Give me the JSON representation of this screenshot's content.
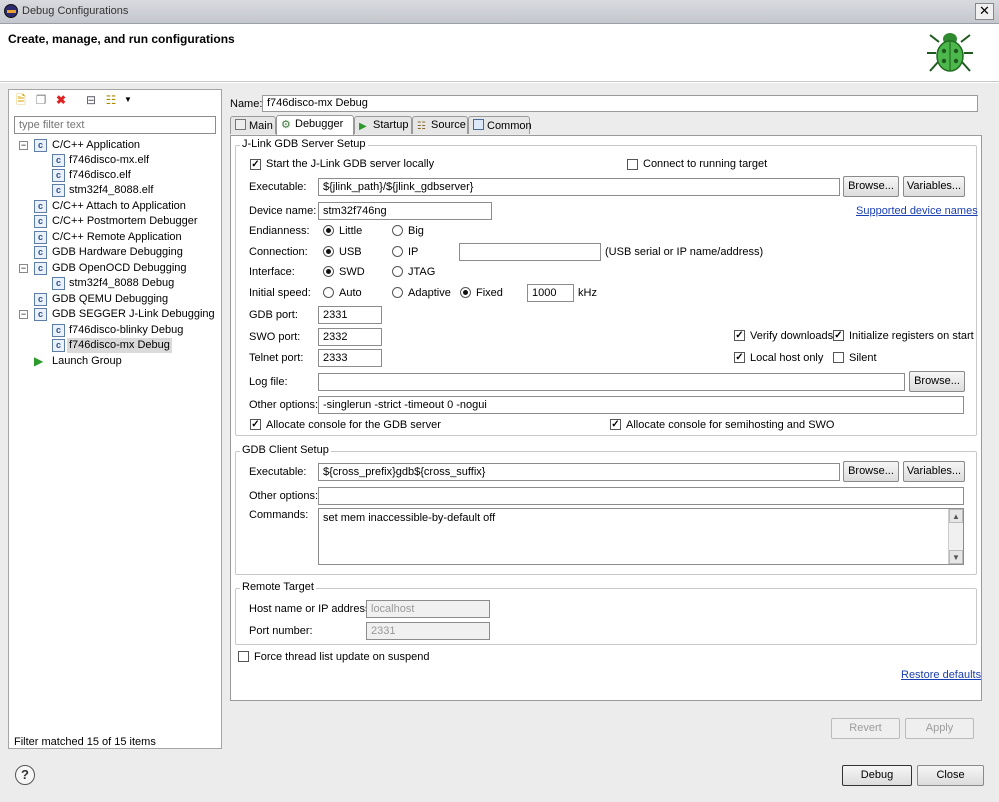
{
  "window": {
    "title": "Debug Configurations",
    "header": "Create, manage, and run configurations",
    "close_glyph": "✕"
  },
  "toolbar": {
    "icons": [
      "new-config-icon",
      "duplicate-icon",
      "delete-icon",
      "collapse-all-icon",
      "filter-icon"
    ]
  },
  "filter": {
    "placeholder": "type filter text",
    "status": "Filter matched 15 of 15 items"
  },
  "tree": [
    {
      "label": "C/C++ Application",
      "level": 0,
      "expanded": true
    },
    {
      "label": "f746disco-mx.elf",
      "level": 1
    },
    {
      "label": "f746disco.elf",
      "level": 1
    },
    {
      "label": "stm32f4_8088.elf",
      "level": 1
    },
    {
      "label": "C/C++ Attach to Application",
      "level": 0
    },
    {
      "label": "C/C++ Postmortem Debugger",
      "level": 0
    },
    {
      "label": "C/C++ Remote Application",
      "level": 0
    },
    {
      "label": "GDB Hardware Debugging",
      "level": 0
    },
    {
      "label": "GDB OpenOCD Debugging",
      "level": 0,
      "expanded": true
    },
    {
      "label": "stm32f4_8088 Debug",
      "level": 1
    },
    {
      "label": "GDB QEMU Debugging",
      "level": 0
    },
    {
      "label": "GDB SEGGER J-Link Debugging",
      "level": 0,
      "expanded": true
    },
    {
      "label": "f746disco-blinky Debug",
      "level": 1
    },
    {
      "label": "f746disco-mx Debug",
      "level": 1,
      "selected": true
    },
    {
      "label": "Launch Group",
      "level": 0
    }
  ],
  "name": {
    "label": "Name:",
    "value": "f746disco-mx Debug"
  },
  "tabs": [
    "Main",
    "Debugger",
    "Startup",
    "Source",
    "Common"
  ],
  "active_tab": "Debugger",
  "server": {
    "group": "J-Link GDB Server Setup",
    "start_locally": "Start the J-Link GDB server locally",
    "connect_running": "Connect to running target",
    "executable_label": "Executable:",
    "executable": "${jlink_path}/${jlink_gdbserver}",
    "device_label": "Device name:",
    "device": "stm32f746ng",
    "supported_link": "Supported device names",
    "endianness_label": "Endianness:",
    "little": "Little",
    "big": "Big",
    "connection_label": "Connection:",
    "usb": "USB",
    "ip": "IP",
    "ip_value": "",
    "ip_hint": "(USB serial or IP name/address)",
    "interface_label": "Interface:",
    "swd": "SWD",
    "jtag": "JTAG",
    "speed_label": "Initial speed:",
    "auto": "Auto",
    "adaptive": "Adaptive",
    "fixed": "Fixed",
    "speed_value": "1000",
    "khz": "kHz",
    "gdb_port_label": "GDB port:",
    "gdb_port": "2331",
    "swo_port_label": "SWO port:",
    "swo_port": "2332",
    "telnet_port_label": "Telnet port:",
    "telnet_port": "2333",
    "verify": "Verify downloads",
    "init_regs": "Initialize registers on start",
    "localhost_only": "Local host only",
    "silent": "Silent",
    "log_label": "Log file:",
    "log_value": "",
    "other_label": "Other options:",
    "other_value": "-singlerun -strict -timeout 0 -nogui",
    "alloc_console": "Allocate console for the GDB server",
    "alloc_semihost": "Allocate console for semihosting and SWO"
  },
  "client": {
    "group": "GDB Client Setup",
    "executable_label": "Executable:",
    "executable": "${cross_prefix}gdb${cross_suffix}",
    "other_label": "Other options:",
    "other_value": "",
    "commands_label": "Commands:",
    "commands": "set mem inaccessible-by-default off"
  },
  "remote": {
    "group": "Remote Target",
    "host_label": "Host name or IP address:",
    "host": "localhost",
    "port_label": "Port number:",
    "port": "2331"
  },
  "force_thread": "Force thread list update on suspend",
  "restore_defaults": "Restore defaults",
  "buttons": {
    "browse": "Browse...",
    "variables": "Variables...",
    "revert": "Revert",
    "apply": "Apply",
    "debug": "Debug",
    "close": "Close"
  },
  "help_glyph": "?"
}
